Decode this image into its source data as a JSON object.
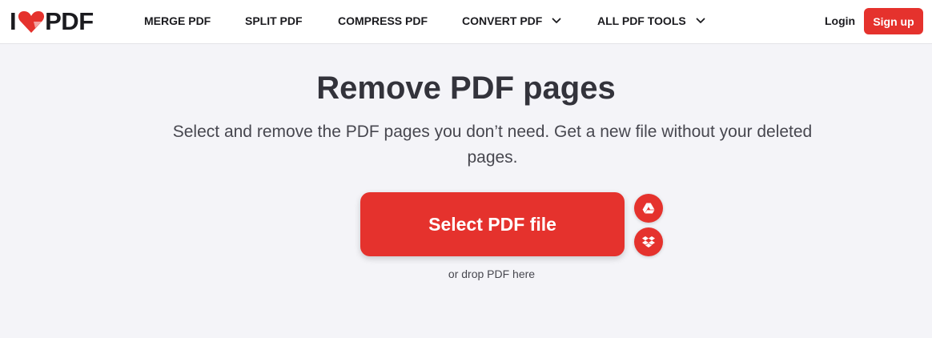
{
  "header": {
    "logo_text_left": "I",
    "logo_text_right": "PDF",
    "nav": [
      {
        "label": "MERGE PDF",
        "dropdown": false
      },
      {
        "label": "SPLIT PDF",
        "dropdown": false
      },
      {
        "label": "COMPRESS PDF",
        "dropdown": false
      },
      {
        "label": "CONVERT PDF",
        "dropdown": true
      },
      {
        "label": "ALL PDF TOOLS",
        "dropdown": true
      }
    ],
    "login_label": "Login",
    "signup_label": "Sign up"
  },
  "main": {
    "title": "Remove PDF pages",
    "subtitle": "Select and remove the PDF pages you don’t need. Get a new file without your deleted pages.",
    "select_button_label": "Select PDF file",
    "drop_hint": "or drop PDF here",
    "cloud_buttons": [
      {
        "icon": "google-drive-icon"
      },
      {
        "icon": "dropbox-icon"
      }
    ]
  },
  "colors": {
    "brand_red": "#e5322d",
    "background": "#f4f4f8",
    "text_dark": "#33333b"
  }
}
